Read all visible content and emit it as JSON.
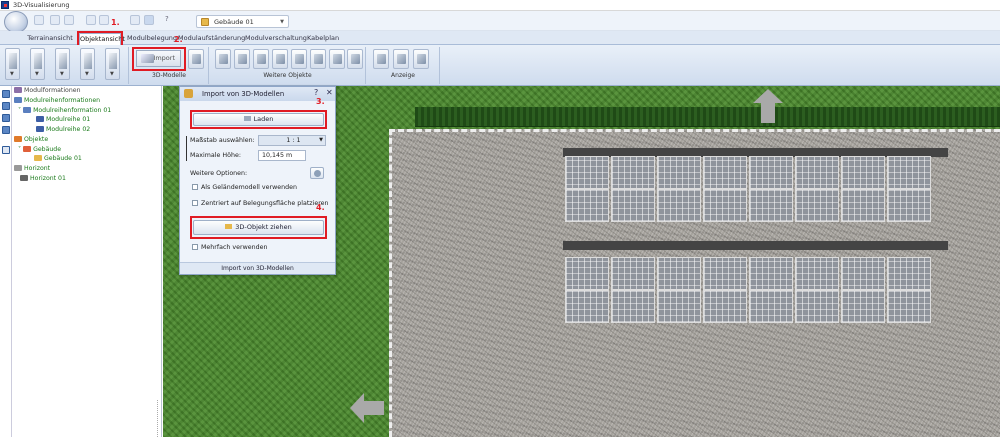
{
  "window": {
    "title": "3D-Visualisierung"
  },
  "toolbar": {
    "building_select": "Gebäude 01"
  },
  "tabs": [
    {
      "label": "Terrainansicht"
    },
    {
      "label": "Objektansicht"
    },
    {
      "label": "Modulbelegung"
    },
    {
      "label": "Modulaufständerung"
    },
    {
      "label": "Modulverschaltung"
    },
    {
      "label": "Kabelplan"
    }
  ],
  "ribbon": {
    "import_label": "Import",
    "groups": [
      "3D-Modelle",
      "Weitere Objekte",
      "Anzeige"
    ]
  },
  "steps": [
    "1.",
    "2.",
    "3.",
    "4."
  ],
  "tree": [
    {
      "label": "Modulformationen",
      "color": "gray",
      "indent": 0
    },
    {
      "label": "Modulreihenformationen",
      "color": "green",
      "indent": 0
    },
    {
      "label": "Modulreihenformation 01",
      "color": "green",
      "indent": 1
    },
    {
      "label": "Modulreihe 01",
      "color": "green",
      "indent": 2
    },
    {
      "label": "Modulreihe 02",
      "color": "green",
      "indent": 2
    },
    {
      "label": "Objekte",
      "color": "green",
      "indent": 0
    },
    {
      "label": "Gebäude",
      "color": "green",
      "indent": 1
    },
    {
      "label": "Gebäude 01",
      "color": "green",
      "indent": 2
    },
    {
      "label": "Horizont",
      "color": "green",
      "indent": 0
    },
    {
      "label": "Horizont 01",
      "color": "green",
      "indent": 1
    }
  ],
  "dialog": {
    "title": "Import von 3D-Modellen",
    "load_button": "Laden",
    "scale_label": "Maßstab auswählen:",
    "scale_value": "1 : 1",
    "max_height_label": "Maximale Höhe:",
    "max_height_value": "10,145 m",
    "more_options_label": "Weitere Optionen:",
    "use_terrain_label": "Als Geländemodell verwenden",
    "center_label": "Zentriert auf Belegungsfläche platzieren",
    "drag_button": "3D-Objekt ziehen",
    "multiple_label": "Mehrfach verwenden",
    "footer": "Import von 3D-Modellen",
    "help": "?",
    "close": "✕"
  },
  "colors": {
    "highlight": "#e01b24",
    "grass": "#4a8a2c",
    "gravel": "#a6a39d"
  }
}
